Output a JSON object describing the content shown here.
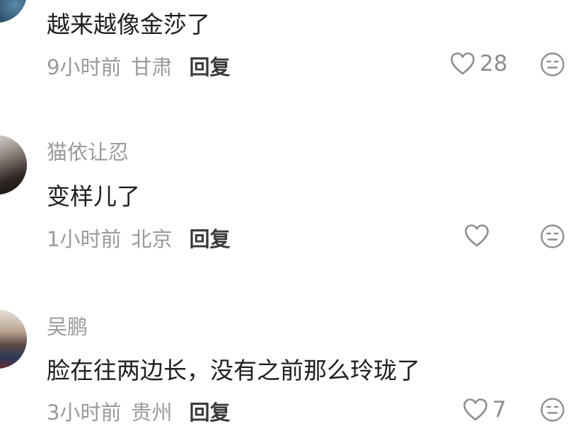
{
  "comments": [
    {
      "username": "",
      "text": "越来越像金莎了",
      "time": "9小时前",
      "location": "甘肃",
      "reply_label": "回复",
      "likes": "28"
    },
    {
      "username": "猫依让忍",
      "text": "变样儿了",
      "time": "1小时前",
      "location": "北京",
      "reply_label": "回复",
      "likes": ""
    },
    {
      "username": "吴鹏",
      "text": "脸在往两边长，没有之前那么玲珑了",
      "time": "3小时前",
      "location": "贵州",
      "reply_label": "回复",
      "likes": "7"
    }
  ],
  "icons": {
    "like": "heart-outline-icon",
    "reaction": "neutral-face-icon"
  },
  "colors": {
    "text": "#1f1f1f",
    "secondary": "#9a9a9a",
    "reply": "#3a3a3a",
    "icon": "#8e8e8e"
  }
}
